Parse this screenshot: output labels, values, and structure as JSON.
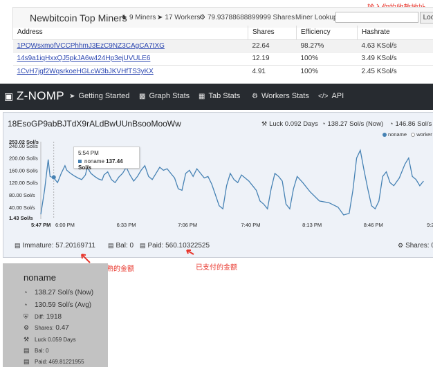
{
  "miners": {
    "title": "Newbitcoin Top Miners",
    "miners_count": "9 Miners",
    "workers_count": "17 Workers",
    "shares": "79.93788688899999 Shares",
    "lookup_label": "Miner Lookup:",
    "lookup_button": "Lookup",
    "annotation": "输入你的收款地址",
    "columns": [
      "Address",
      "Shares",
      "Efficiency",
      "Hashrate"
    ],
    "rows": [
      {
        "address": "1PQWsxmofVCCPhhmJ3EzC9NZ3CAgCA7tXG",
        "shares": "22.64",
        "efficiency": "98.27%",
        "hashrate": "4.63 KSol/s"
      },
      {
        "address": "14s9a1iqHxxQJ5pkJA6w424Hp3ejUVULE6",
        "shares": "12.19",
        "efficiency": "100%",
        "hashrate": "3.49 KSol/s"
      },
      {
        "address": "1CvH7jgf2WqsrkoeHGLcW3bJKVHfTS3yKX",
        "shares": "4.91",
        "efficiency": "100%",
        "hashrate": "2.45 KSol/s"
      }
    ]
  },
  "nav": {
    "brand": "Z-NOMP",
    "items": [
      {
        "label": "Getting Started",
        "icon": "rocket-icon"
      },
      {
        "label": "Graph Stats",
        "icon": "chart-icon"
      },
      {
        "label": "Tab Stats",
        "icon": "table-icon"
      },
      {
        "label": "Workers Stats",
        "icon": "gears-icon"
      },
      {
        "label": "API",
        "icon": "code-icon"
      }
    ]
  },
  "stats": {
    "address": "18EsoGP9abBJTdX9rALdBwUUnBsooMooWw",
    "luck": "Luck 0.092 Days",
    "hash_now": "138.27 Sol/s (Now)",
    "hash_avg": "146.86 Sol/s",
    "immature": "Immature: 57.20169711",
    "bal": "Bal: 0",
    "paid": "Paid: 560.10322525",
    "shares": "Shares: 0.",
    "annotation_immature": "新鲜挖出未成熟的金额",
    "annotation_paid": "已支付的金额",
    "tooltip": {
      "time": "5:54 PM",
      "series": "noname",
      "value": "137.44 Sol/s"
    }
  },
  "chart_data": {
    "type": "line",
    "title": "",
    "xlabel": "",
    "ylabel": "",
    "y_max_label": "253.02 Sol/s",
    "y_min_label": "1.43 Sol/s",
    "ylim": [
      1.43,
      253.02
    ],
    "y_ticks": [
      40,
      80,
      120,
      160,
      200,
      240
    ],
    "y_tick_labels": [
      "40.00 Sol/s",
      "80.00 Sol/s",
      "120.00 Sol/s",
      "160.00 Sol/s",
      "200.00 Sol/s",
      "240.00 Sol/s"
    ],
    "x_ticks": [
      "5:47 PM",
      "6:00 PM",
      "6:33 PM",
      "7:06 PM",
      "7:40 PM",
      "8:13 PM",
      "8:46 PM",
      "9:20 PM",
      "9:3"
    ],
    "legend": [
      "noname",
      "worker"
    ],
    "legend_position": "top-right",
    "grid": false,
    "colors": {
      "noname": "#4682b4",
      "worker": "#ffffff"
    },
    "series": [
      {
        "name": "noname",
        "x_minutes_since_547pm": [
          0,
          2,
          4,
          5,
          7,
          9,
          11,
          13,
          14,
          16,
          18,
          20,
          22,
          24,
          25,
          27,
          29,
          31,
          33,
          34,
          36,
          38,
          40,
          42,
          44,
          46,
          48,
          50,
          52,
          54,
          56,
          58,
          60,
          62,
          64,
          66,
          68,
          70,
          72,
          74,
          76,
          78,
          80,
          82,
          84,
          86,
          88,
          90,
          92,
          94,
          96,
          98,
          100,
          102,
          104,
          106,
          108,
          110,
          112,
          114,
          116,
          118,
          120,
          122,
          124,
          126,
          128,
          130,
          132,
          134,
          136,
          138,
          141,
          145,
          150,
          155,
          160,
          163,
          166,
          168,
          170,
          172,
          174,
          176,
          178,
          180,
          182,
          184,
          186,
          188,
          190,
          193,
          196,
          198,
          200,
          202,
          204,
          206
        ],
        "values": [
          17,
          95,
          195,
          140,
          135,
          120,
          150,
          175,
          160,
          150,
          142,
          135,
          130,
          145,
          170,
          150,
          140,
          132,
          128,
          145,
          155,
          130,
          120,
          138,
          150,
          170,
          145,
          125,
          140,
          160,
          175,
          140,
          130,
          150,
          170,
          160,
          165,
          150,
          135,
          100,
          95,
          150,
          160,
          140,
          165,
          150,
          135,
          140,
          115,
          80,
          45,
          35,
          110,
          150,
          130,
          120,
          145,
          135,
          125,
          110,
          95,
          60,
          50,
          35,
          100,
          150,
          140,
          125,
          50,
          35,
          100,
          140,
          120,
          90,
          60,
          55,
          40,
          15,
          20,
          95,
          200,
          225,
          160,
          100,
          45,
          35,
          60,
          140,
          155,
          120,
          110,
          135,
          180,
          200,
          140,
          130,
          110,
          125
        ]
      }
    ]
  },
  "worker": {
    "name": "noname",
    "now": "138.27 Sol/s (Now)",
    "avg": "130.59 Sol/s (Avg)",
    "diff": "1918",
    "diff_label": "Diff:",
    "shares_label": "Shares:",
    "shares": "0.47",
    "luck": "Luck 0.059 Days",
    "bal": "Bal: 0",
    "paid": "Paid: 469.81221955"
  }
}
